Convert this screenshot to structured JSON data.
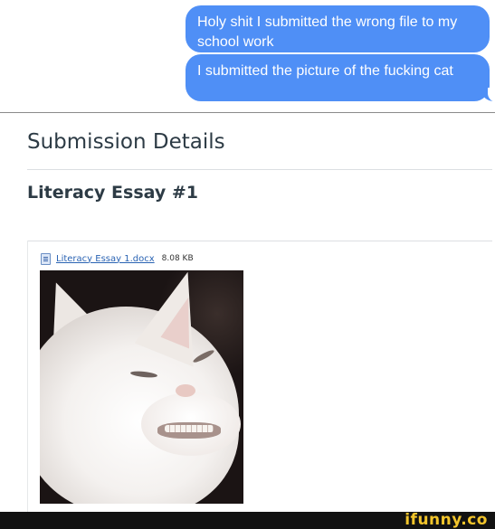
{
  "messages": [
    {
      "text": "Holy shit I submitted the wrong file to my school work"
    },
    {
      "text": "I submitted the picture of the fucking cat"
    }
  ],
  "submission": {
    "title": "Submission Details",
    "assignment": "Literacy Essay #1",
    "file": {
      "name": "Literacy Essay 1.docx",
      "size": "8.08 KB",
      "icon": "document-icon"
    }
  },
  "watermark": "ifunny.co",
  "colors": {
    "bubble": "#4f8ff6",
    "link": "#2a63b3",
    "watermark": "#f3c52b"
  }
}
